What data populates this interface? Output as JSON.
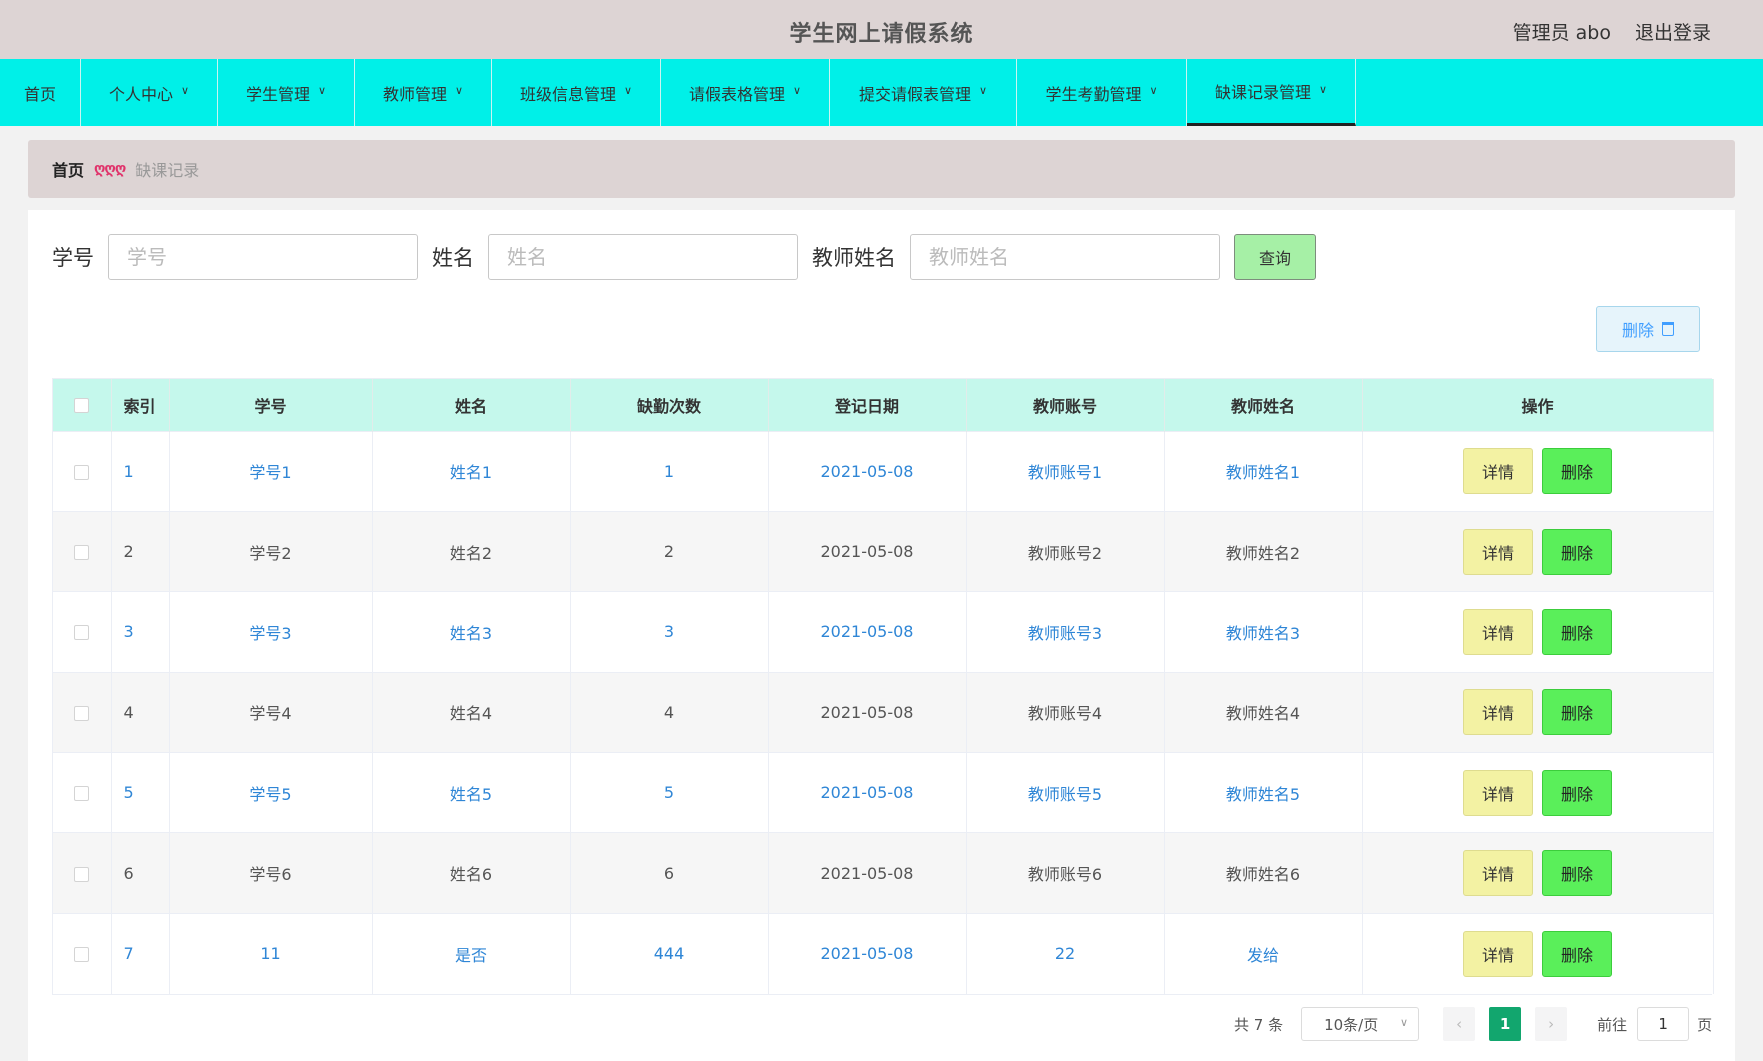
{
  "header": {
    "title": "学生网上请假系统",
    "user": "管理员 abo",
    "logout": "退出登录"
  },
  "nav": [
    {
      "label": "首页",
      "dropdown": false,
      "active": false
    },
    {
      "label": "个人中心",
      "dropdown": true,
      "active": false
    },
    {
      "label": "学生管理",
      "dropdown": true,
      "active": false
    },
    {
      "label": "教师管理",
      "dropdown": true,
      "active": false
    },
    {
      "label": "班级信息管理",
      "dropdown": true,
      "active": false
    },
    {
      "label": "请假表格管理",
      "dropdown": true,
      "active": false
    },
    {
      "label": "提交请假表管理",
      "dropdown": true,
      "active": false
    },
    {
      "label": "学生考勤管理",
      "dropdown": true,
      "active": false
    },
    {
      "label": "缺课记录管理",
      "dropdown": true,
      "active": true
    }
  ],
  "breadcrumb": {
    "home": "首页",
    "separator": "ღღღ",
    "current": "缺课记录"
  },
  "search": {
    "fields": [
      {
        "label": "学号",
        "placeholder": "学号",
        "value": ""
      },
      {
        "label": "姓名",
        "placeholder": "姓名",
        "value": ""
      },
      {
        "label": "教师姓名",
        "placeholder": "教师姓名",
        "value": ""
      }
    ],
    "query_label": "查询"
  },
  "batch_delete_label": "删除",
  "table": {
    "headers": [
      "索引",
      "学号",
      "姓名",
      "缺勤次数",
      "登记日期",
      "教师账号",
      "教师姓名",
      "操作"
    ],
    "rows": [
      [
        "1",
        "学号1",
        "姓名1",
        "1",
        "2021-05-08",
        "教师账号1",
        "教师姓名1"
      ],
      [
        "2",
        "学号2",
        "姓名2",
        "2",
        "2021-05-08",
        "教师账号2",
        "教师姓名2"
      ],
      [
        "3",
        "学号3",
        "姓名3",
        "3",
        "2021-05-08",
        "教师账号3",
        "教师姓名3"
      ],
      [
        "4",
        "学号4",
        "姓名4",
        "4",
        "2021-05-08",
        "教师账号4",
        "教师姓名4"
      ],
      [
        "5",
        "学号5",
        "姓名5",
        "5",
        "2021-05-08",
        "教师账号5",
        "教师姓名5"
      ],
      [
        "6",
        "学号6",
        "姓名6",
        "6",
        "2021-05-08",
        "教师账号6",
        "教师姓名6"
      ],
      [
        "7",
        "11",
        "是否",
        "444",
        "2021-05-08",
        "22",
        "发给"
      ]
    ],
    "detail_label": "详情",
    "delete_label": "删除"
  },
  "pagination": {
    "total": "共 7 条",
    "page_size": "10条/页",
    "current_page": "1",
    "goto_label": "前往",
    "goto_value": "1",
    "page_unit": "页",
    "prev_icon": "‹",
    "next_icon": "›"
  },
  "colors": {
    "header_bg": "#ddd4d4",
    "nav_bg": "#00f0e8",
    "table_header_bg": "#c5f8ec",
    "link_blue": "#2f86d6",
    "detail_btn": "#f3f2a3",
    "delete_btn": "#5aef5a",
    "query_btn": "#a6f0a6",
    "active_page": "#12a66e"
  }
}
